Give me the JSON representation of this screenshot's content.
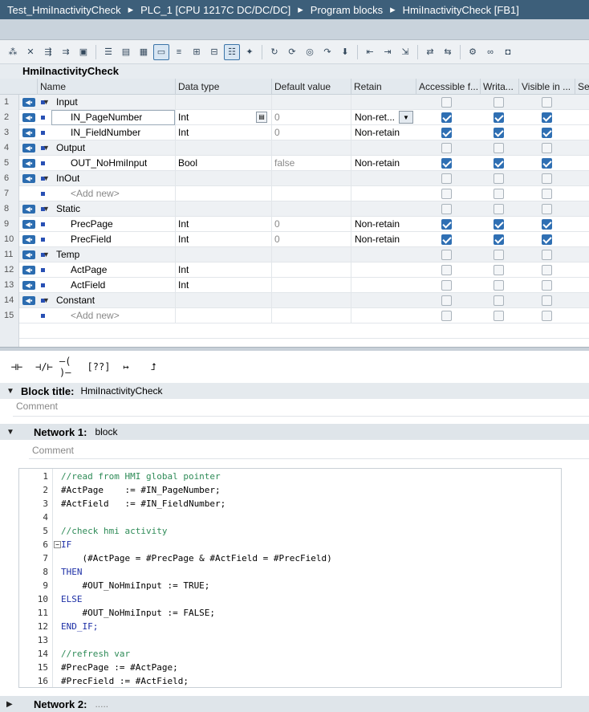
{
  "breadcrumb": [
    "Test_HmiInactivityCheck",
    "PLC_1 [CPU 1217C DC/DC/DC]",
    "Program blocks",
    "HmiInactivityCheck [FB1]"
  ],
  "breadcrumb_separator": "▸",
  "block_name": "HmiInactivityCheck",
  "interface": {
    "columns": [
      "Name",
      "Data type",
      "Default value",
      "Retain",
      "Accessible f...",
      "Writa...",
      "Visible in ...",
      "Set"
    ],
    "rows": [
      {
        "num": "1",
        "kind": "section",
        "name": "Input",
        "type": "",
        "default": "",
        "retain": "",
        "acc": false,
        "write": false,
        "vis": false
      },
      {
        "num": "2",
        "kind": "var",
        "name": "IN_PageNumber",
        "type": "Int",
        "default": "0",
        "retain": "Non-ret...",
        "acc": true,
        "write": true,
        "vis": true,
        "editing": true
      },
      {
        "num": "3",
        "kind": "var",
        "name": "IN_FieldNumber",
        "type": "Int",
        "default": "0",
        "retain": "Non-retain",
        "acc": true,
        "write": true,
        "vis": true
      },
      {
        "num": "4",
        "kind": "section",
        "name": "Output",
        "type": "",
        "default": "",
        "retain": "",
        "acc": false,
        "write": false,
        "vis": false
      },
      {
        "num": "5",
        "kind": "var",
        "name": "OUT_NoHmiInput",
        "type": "Bool",
        "default": "false",
        "retain": "Non-retain",
        "acc": true,
        "write": true,
        "vis": true
      },
      {
        "num": "6",
        "kind": "section",
        "name": "InOut",
        "type": "",
        "default": "",
        "retain": "",
        "acc": false,
        "write": false,
        "vis": false
      },
      {
        "num": "7",
        "kind": "add",
        "name": "<Add new>",
        "type": "",
        "default": "",
        "retain": "",
        "acc": false,
        "write": false,
        "vis": false
      },
      {
        "num": "8",
        "kind": "section",
        "name": "Static",
        "type": "",
        "default": "",
        "retain": "",
        "acc": false,
        "write": false,
        "vis": false
      },
      {
        "num": "9",
        "kind": "var",
        "name": "PrecPage",
        "type": "Int",
        "default": "0",
        "retain": "Non-retain",
        "acc": true,
        "write": true,
        "vis": true
      },
      {
        "num": "10",
        "kind": "var",
        "name": "PrecField",
        "type": "Int",
        "default": "0",
        "retain": "Non-retain",
        "acc": true,
        "write": true,
        "vis": true
      },
      {
        "num": "11",
        "kind": "section",
        "name": "Temp",
        "type": "",
        "default": "",
        "retain": "",
        "acc": false,
        "write": false,
        "vis": false
      },
      {
        "num": "12",
        "kind": "var",
        "name": "ActPage",
        "type": "Int",
        "default": "",
        "retain": "",
        "acc": false,
        "write": false,
        "vis": false
      },
      {
        "num": "13",
        "kind": "var",
        "name": "ActField",
        "type": "Int",
        "default": "",
        "retain": "",
        "acc": false,
        "write": false,
        "vis": false
      },
      {
        "num": "14",
        "kind": "section",
        "name": "Constant",
        "type": "",
        "default": "",
        "retain": "",
        "acc": false,
        "write": false,
        "vis": false
      },
      {
        "num": "15",
        "kind": "add",
        "name": "<Add new>",
        "type": "",
        "default": "",
        "retain": "",
        "acc": false,
        "write": false,
        "vis": false
      }
    ]
  },
  "ladder_buttons": [
    "⊣⊢",
    "⊣/⊢",
    "–( )–",
    "[??]",
    "↦",
    "⮥"
  ],
  "block_title": {
    "label": "Block title:",
    "value": "HmiInactivityCheck",
    "comment": "Comment"
  },
  "network1": {
    "label": "Network 1:",
    "title": "block",
    "comment": "Comment"
  },
  "code_lines": [
    {
      "n": "1",
      "text": "//read from HMI global pointer",
      "cls": "cm"
    },
    {
      "n": "2",
      "text": "#ActPage    := #IN_PageNumber;",
      "cls": ""
    },
    {
      "n": "3",
      "text": "#ActField   := #IN_FieldNumber;",
      "cls": ""
    },
    {
      "n": "4",
      "text": "",
      "cls": ""
    },
    {
      "n": "5",
      "text": "//check hmi activity",
      "cls": "cm"
    },
    {
      "n": "6",
      "text": "IF",
      "cls": "kw",
      "fold": "−"
    },
    {
      "n": "7",
      "text": "    (#ActPage = #PrecPage & #ActField = #PrecField)",
      "cls": ""
    },
    {
      "n": "8",
      "text": "THEN",
      "cls": "kw"
    },
    {
      "n": "9",
      "text": "    #OUT_NoHmiInput := TRUE;",
      "cls": ""
    },
    {
      "n": "10",
      "text": "ELSE",
      "cls": "kw"
    },
    {
      "n": "11",
      "text": "    #OUT_NoHmiInput := FALSE;",
      "cls": ""
    },
    {
      "n": "12",
      "text": "END_IF;",
      "cls": "kw"
    },
    {
      "n": "13",
      "text": "",
      "cls": ""
    },
    {
      "n": "14",
      "text": "//refresh var",
      "cls": "cm"
    },
    {
      "n": "15",
      "text": "#PrecPage := #ActPage;",
      "cls": ""
    },
    {
      "n": "16",
      "text": "#PrecField := #ActField;",
      "cls": ""
    }
  ],
  "network2": {
    "label": "Network 2:",
    "title": "....."
  },
  "colors": {
    "titlebar": "#3d5f7a",
    "accent": "#2f6fb3"
  }
}
